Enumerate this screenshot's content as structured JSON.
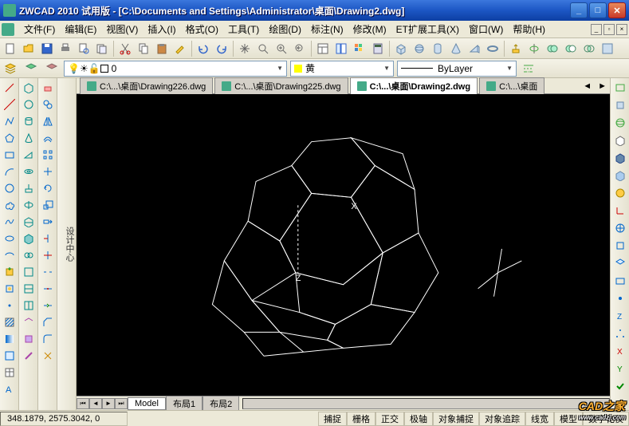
{
  "window": {
    "title": "ZWCAD 2010 试用版 - [C:\\Documents and Settings\\Administrator\\桌面\\Drawing2.dwg]"
  },
  "menu": {
    "file": "文件(F)",
    "edit": "编辑(E)",
    "view": "视图(V)",
    "insert": "插入(I)",
    "format": "格式(O)",
    "tools": "工具(T)",
    "draw": "绘图(D)",
    "dim": "标注(N)",
    "modify": "修改(M)",
    "et": "ET扩展工具(X)",
    "window": "窗口(W)",
    "help": "帮助(H)"
  },
  "layer": {
    "current": "0"
  },
  "color": {
    "current": "黄"
  },
  "linetype": {
    "current": "ByLayer"
  },
  "doctabs": [
    {
      "label": "C:\\...\\桌面\\Drawing226.dwg",
      "active": false
    },
    {
      "label": "C:\\...\\桌面\\Drawing225.dwg",
      "active": false
    },
    {
      "label": "C:\\...\\桌面\\Drawing2.dwg",
      "active": true
    },
    {
      "label": "C:\\...\\桌面",
      "active": false
    }
  ],
  "model_tabs": {
    "model": "Model",
    "layout1": "布局1",
    "layout2": "布局2"
  },
  "status": {
    "coords": "348.1879, 2575.3042, 0",
    "snap": "捕捉",
    "grid": "栅格",
    "ortho": "正交",
    "polar": "极轴",
    "osnap": "对象捕捉",
    "otrack": "对象追踪",
    "lwt": "线宽",
    "model": "模型",
    "dyn": "数字化仪"
  },
  "axis": {
    "x": "X",
    "z": "Z"
  },
  "palette_label": "设计中心",
  "watermark": {
    "main": "CAD之家",
    "sub": "www.cadzj.com"
  }
}
